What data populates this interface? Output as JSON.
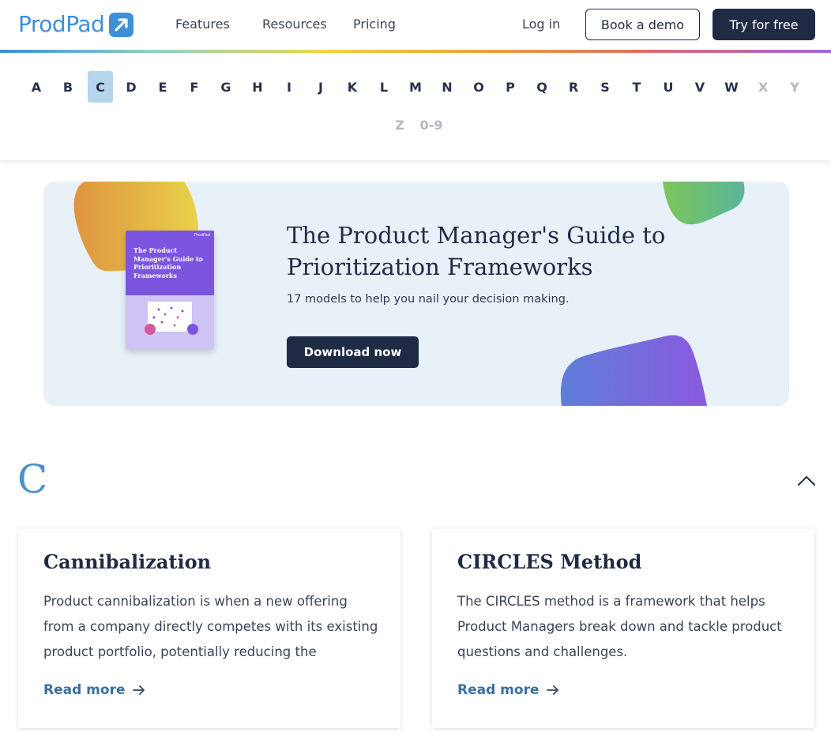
{
  "header": {
    "logo_text": "ProdPad",
    "nav": [
      "Features",
      "Resources",
      "Pricing"
    ],
    "login": "Log in",
    "demo_button": "Book a demo",
    "trial_button": "Try for free"
  },
  "alphabet": {
    "letters": [
      "A",
      "B",
      "C",
      "D",
      "E",
      "F",
      "G",
      "H",
      "I",
      "J",
      "K",
      "L",
      "M",
      "N",
      "O",
      "P",
      "Q",
      "R",
      "S",
      "T",
      "U",
      "V",
      "W",
      "X",
      "Y"
    ],
    "row2": [
      "Z",
      "0-9"
    ],
    "active": "C",
    "disabled": [
      "X",
      "Y",
      "Z",
      "0-9"
    ]
  },
  "banner": {
    "title": "The Product Manager's Guide to Prioritization Frameworks",
    "subtitle": "17 models to help you nail your decision making.",
    "button": "Download now",
    "book_brand": "ProdPad",
    "book_title": "The Product Manager's Guide to Prioritization Frameworks",
    "colors": {
      "background": "#e8f0f8",
      "blob_orange": "#e8a43c",
      "blob_green": "#6fc070",
      "blob_purple": "#7b5fe0",
      "book": "#7b55e0"
    }
  },
  "section": {
    "letter": "C",
    "cards": [
      {
        "title": "Cannibalization",
        "description": "Product cannibalization is when a new offering from a company directly competes with its existing product portfolio, potentially reducing the original...",
        "link": "Read more"
      },
      {
        "title": "CIRCLES Method",
        "description": "The CIRCLES method is a framework that helps Product Managers break down and tackle product questions and challenges.",
        "link": "Read more"
      }
    ]
  },
  "colors": {
    "navy": "#1f2a44",
    "brand_blue": "#3d8fd6",
    "active_letter_bg": "#b4d5ec",
    "link": "#3a6f9e"
  }
}
